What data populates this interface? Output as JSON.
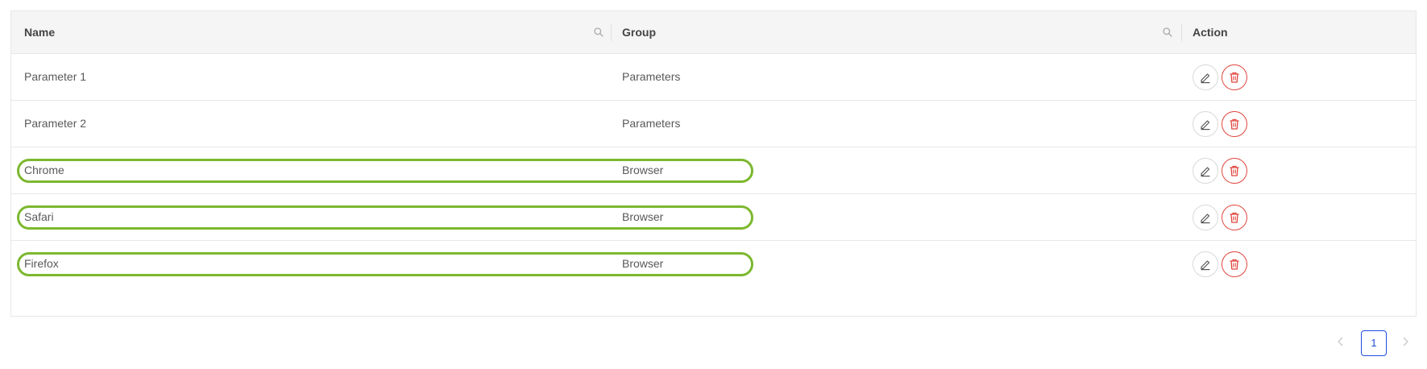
{
  "table": {
    "columns": {
      "name": "Name",
      "group": "Group",
      "action": "Action"
    },
    "rows": [
      {
        "name": "Parameter 1",
        "group": "Parameters",
        "highlighted": false
      },
      {
        "name": "Parameter 2",
        "group": "Parameters",
        "highlighted": false
      },
      {
        "name": "Chrome",
        "group": "Browser",
        "highlighted": true
      },
      {
        "name": "Safari",
        "group": "Browser",
        "highlighted": true
      },
      {
        "name": "Firefox",
        "group": "Browser",
        "highlighted": true
      }
    ],
    "icons": {
      "column_search": "search-icon",
      "edit": "pencil-icon",
      "delete": "trash-icon"
    }
  },
  "pagination": {
    "current_page": "1",
    "prev_icon": "chevron-left-icon",
    "next_icon": "chevron-right-icon"
  },
  "colors": {
    "highlight": "#7cb82f",
    "delete": "#e0453d",
    "active_page": "#1d4fd8",
    "header_bg": "#f5f5f5"
  }
}
